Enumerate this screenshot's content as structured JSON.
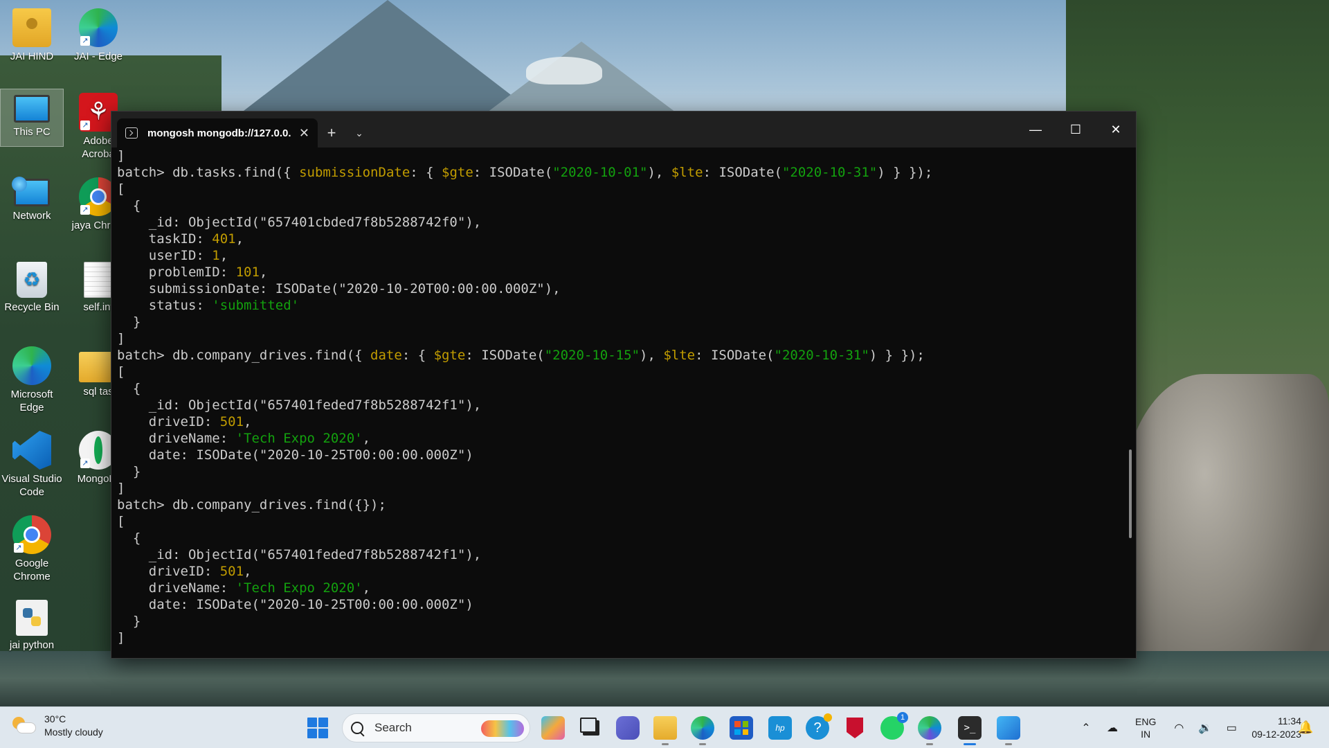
{
  "desktop": {
    "icons": [
      {
        "label": "JAI HIND",
        "icon": "folder-person-icon"
      },
      {
        "label": "JAI - Edge",
        "icon": "edge-icon"
      },
      {
        "label": "This PC",
        "icon": "monitor-icon"
      },
      {
        "label": "Adobe Acroba",
        "icon": "acrobat-icon"
      },
      {
        "label": "Network",
        "icon": "network-icon"
      },
      {
        "label": "jaya Chrom",
        "icon": "chrome-icon"
      },
      {
        "label": "Recycle Bin",
        "icon": "recycle-bin-icon"
      },
      {
        "label": "self.int",
        "icon": "document-icon"
      },
      {
        "label": "Microsoft Edge",
        "icon": "edge-icon"
      },
      {
        "label": "sql tas",
        "icon": "folder-icon"
      },
      {
        "label": "Visual Studio Code",
        "icon": "vscode-icon"
      },
      {
        "label": "MongoDI",
        "icon": "mongodb-icon"
      },
      {
        "label": "Google Chrome",
        "icon": "chrome-icon"
      },
      {
        "label": "jai python",
        "icon": "python-icon"
      }
    ]
  },
  "terminal": {
    "tab_title": "mongosh mongodb://127.0.0.",
    "tab_close": "✕",
    "new_tab": "+",
    "dropdown": "⌄",
    "minimize": "—",
    "maximize": "☐",
    "close": "✕",
    "lines": [
      [
        {
          "t": "]"
        }
      ],
      [
        {
          "t": "batch> db.tasks.find({ "
        },
        {
          "t": "submissionDate",
          "c": "kw"
        },
        {
          "t": ": { "
        },
        {
          "t": "$gte",
          "c": "kw"
        },
        {
          "t": ": ISODate("
        },
        {
          "t": "\"2020-10-01\"",
          "c": "str"
        },
        {
          "t": "), "
        },
        {
          "t": "$lte",
          "c": "kw"
        },
        {
          "t": ": ISODate("
        },
        {
          "t": "\"2020-10-31\"",
          "c": "str"
        },
        {
          "t": ") } });"
        }
      ],
      [
        {
          "t": "["
        }
      ],
      [
        {
          "t": "  {"
        }
      ],
      [
        {
          "t": "    _id: ObjectId(\"657401cbded7f8b5288742f0\"),"
        }
      ],
      [
        {
          "t": "    taskID: "
        },
        {
          "t": "401",
          "c": "kw"
        },
        {
          "t": ","
        }
      ],
      [
        {
          "t": "    userID: "
        },
        {
          "t": "1",
          "c": "kw"
        },
        {
          "t": ","
        }
      ],
      [
        {
          "t": "    problemID: "
        },
        {
          "t": "101",
          "c": "kw"
        },
        {
          "t": ","
        }
      ],
      [
        {
          "t": "    submissionDate: ISODate(\"2020-10-20T00:00:00.000Z\"),"
        }
      ],
      [
        {
          "t": "    status: "
        },
        {
          "t": "'submitted'",
          "c": "str"
        }
      ],
      [
        {
          "t": "  }"
        }
      ],
      [
        {
          "t": "]"
        }
      ],
      [
        {
          "t": "batch> db.company_drives.find({ "
        },
        {
          "t": "date",
          "c": "kw"
        },
        {
          "t": ": { "
        },
        {
          "t": "$gte",
          "c": "kw"
        },
        {
          "t": ": ISODate("
        },
        {
          "t": "\"2020-10-15\"",
          "c": "str"
        },
        {
          "t": "), "
        },
        {
          "t": "$lte",
          "c": "kw"
        },
        {
          "t": ": ISODate("
        },
        {
          "t": "\"2020-10-31\"",
          "c": "str"
        },
        {
          "t": ") } });"
        }
      ],
      [
        {
          "t": "["
        }
      ],
      [
        {
          "t": "  {"
        }
      ],
      [
        {
          "t": "    _id: ObjectId(\"657401feded7f8b5288742f1\"),"
        }
      ],
      [
        {
          "t": "    driveID: "
        },
        {
          "t": "501",
          "c": "kw"
        },
        {
          "t": ","
        }
      ],
      [
        {
          "t": "    driveName: "
        },
        {
          "t": "'Tech Expo 2020'",
          "c": "str"
        },
        {
          "t": ","
        }
      ],
      [
        {
          "t": "    date: ISODate(\"2020-10-25T00:00:00.000Z\")"
        }
      ],
      [
        {
          "t": "  }"
        }
      ],
      [
        {
          "t": "]"
        }
      ],
      [
        {
          "t": "batch> db.company_drives.find({});"
        }
      ],
      [
        {
          "t": "["
        }
      ],
      [
        {
          "t": "  {"
        }
      ],
      [
        {
          "t": "    _id: ObjectId(\"657401feded7f8b5288742f1\"),"
        }
      ],
      [
        {
          "t": "    driveID: "
        },
        {
          "t": "501",
          "c": "kw"
        },
        {
          "t": ","
        }
      ],
      [
        {
          "t": "    driveName: "
        },
        {
          "t": "'Tech Expo 2020'",
          "c": "str"
        },
        {
          "t": ","
        }
      ],
      [
        {
          "t": "    date: ISODate(\"2020-10-25T00:00:00.000Z\")"
        }
      ],
      [
        {
          "t": "  }"
        }
      ],
      [
        {
          "t": "]"
        }
      ]
    ]
  },
  "colors": {
    "keyword": "#c19c00",
    "string": "#13a10e",
    "text": "#cccccc",
    "terminal_bg": "#0c0c0c"
  },
  "taskbar": {
    "weather_temp": "30°C",
    "weather_desc": "Mostly cloudy",
    "search_placeholder": "Search",
    "apps": [
      {
        "name": "copilot-icon"
      },
      {
        "name": "task-view-icon"
      },
      {
        "name": "teams-meet-icon"
      },
      {
        "name": "file-explorer-icon"
      },
      {
        "name": "edge-icon"
      },
      {
        "name": "store-icon"
      },
      {
        "name": "myhp-icon"
      },
      {
        "name": "help-icon"
      },
      {
        "name": "mcafee-icon"
      },
      {
        "name": "whatsapp-icon",
        "badge": "1"
      },
      {
        "name": "edge-dev-icon"
      },
      {
        "name": "terminal-icon",
        "active": true
      },
      {
        "name": "photos-icon"
      }
    ],
    "tray": {
      "lang_top": "ENG",
      "lang_bottom": "IN",
      "time": "11:34",
      "date": "09-12-2023"
    }
  }
}
